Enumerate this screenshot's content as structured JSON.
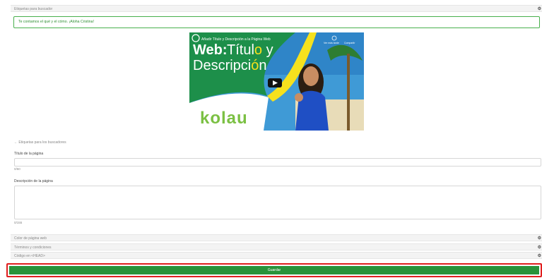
{
  "sections": {
    "seo": "Etiquetas para buscador",
    "color": "Color de página web",
    "terms": "Términos y condiciones",
    "head_code": "Código en <HEAD>"
  },
  "toggle_symbol": "⚙",
  "hint": "Te contamos el qué y el cómo. ¡Aloha Cristina!",
  "video": {
    "small_title": "Añadir Título y Descripción a la Página Web",
    "big_line1a": "Web:",
    "big_line1b": "Títul",
    "big_line1c": "o",
    "big_line1d": " y",
    "big_line2a": "Descripci",
    "big_line2b": "ó",
    "big_line2c": "n",
    "brand": "kolau",
    "later": "Ver más tarde",
    "share": "Compartir"
  },
  "back_link": "← Etiquetas para los buscadores",
  "title_label": "Título de la página",
  "title_value": "",
  "title_counter": "0/60",
  "desc_label": "Descripción de la página",
  "desc_value": "",
  "desc_counter": "0/155",
  "save": "Guardar",
  "colors": {
    "accent": "#28933a",
    "highlight_border": "#e01e1e",
    "hint_border": "#48b04c"
  }
}
